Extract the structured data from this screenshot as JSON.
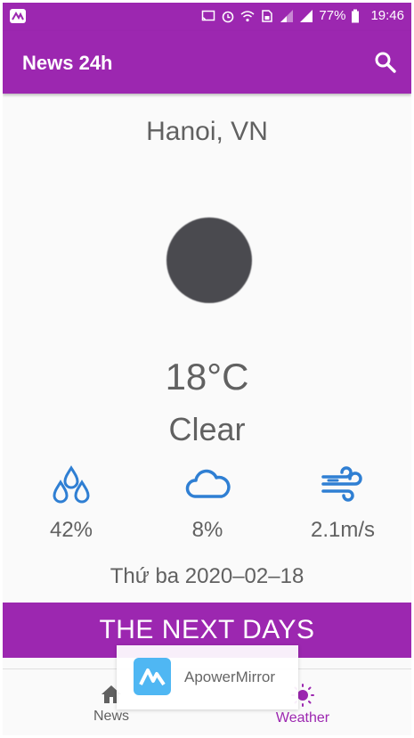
{
  "status_bar": {
    "battery": "77%",
    "time": "19:46",
    "icons": [
      "apowermirror-icon",
      "cast-icon",
      "alarm-icon",
      "wifi-icon",
      "sim-icon",
      "signal-icon",
      "signal-icon",
      "battery-icon"
    ]
  },
  "app_bar": {
    "title": "News 24h",
    "search_icon": "search-icon"
  },
  "weather": {
    "city": "Hanoi, VN",
    "icon": "weather-condition-icon",
    "temperature": "18°C",
    "condition": "Clear",
    "stats": [
      {
        "icon": "humidity-icon",
        "value": "42%"
      },
      {
        "icon": "cloud-icon",
        "value": "8%"
      },
      {
        "icon": "wind-icon",
        "value": "2.1m/s"
      }
    ],
    "date": "Thứ ba 2020–02–18"
  },
  "next_days": {
    "label": "THE NEXT DAYS"
  },
  "bottom_nav": {
    "items": [
      {
        "label": "News",
        "icon": "home-icon",
        "active": false
      },
      {
        "label": "Weather",
        "icon": "sun-icon",
        "active": true
      }
    ]
  },
  "overlay": {
    "app_name": "ApowerMirror"
  },
  "colors": {
    "primary": "#9c27b0",
    "stat_icon": "#2f7fd3",
    "text": "#616161",
    "inactive_nav": "#616161"
  }
}
